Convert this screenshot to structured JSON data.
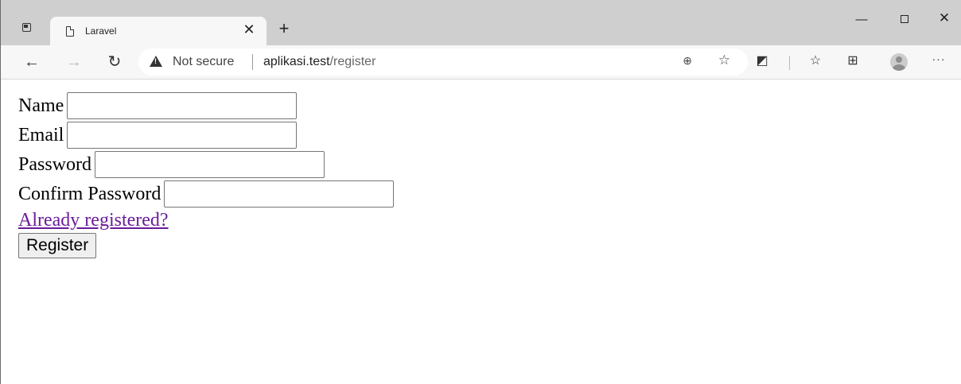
{
  "browser": {
    "tab": {
      "title": "Laravel",
      "close_glyph": "✕"
    },
    "new_tab_glyph": "+",
    "window_controls": {
      "minimize": "—",
      "close": "✕"
    },
    "nav": {
      "back": "←",
      "forward": "→",
      "reload": "↻"
    },
    "address": {
      "security_text": "Not secure",
      "host": "aplikasi.test",
      "path": "/register"
    },
    "icons": {
      "zoom": "⊕",
      "add_favorite": "☆",
      "extensions": "◩",
      "favorites": "☆",
      "collections": "⊞",
      "more": "···"
    }
  },
  "form": {
    "name_label": "Name",
    "email_label": "Email",
    "password_label": "Password",
    "confirm_password_label": "Confirm Password",
    "login_link": "Already registered?",
    "register_button": "Register"
  }
}
